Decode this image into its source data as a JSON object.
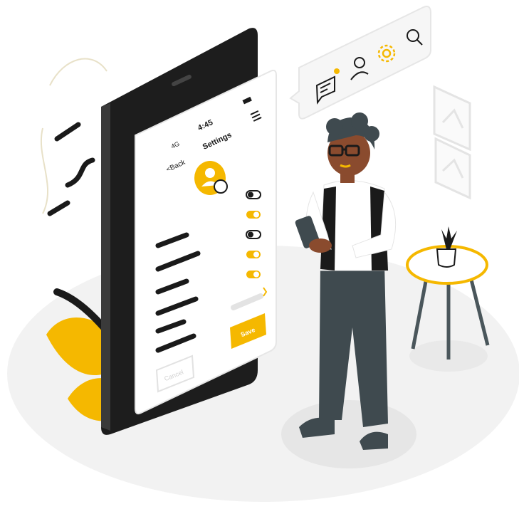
{
  "colors": {
    "accent": "#f5b800",
    "dark": "#1a1a1a",
    "phone_body": "#1d1d1d",
    "screen_bg": "#ffffff",
    "floor": "#f0f0f0",
    "pants": "#3f4a4f",
    "skin": "#8a4b2e"
  },
  "phone": {
    "status": {
      "signal": "4G",
      "time": "4:45"
    },
    "header": {
      "back_label": "<Back",
      "title": "Settings"
    },
    "toggles": [
      {
        "state": "off"
      },
      {
        "state": "on"
      },
      {
        "state": "off"
      },
      {
        "state": "on"
      },
      {
        "state": "on"
      }
    ],
    "save_label": "Save",
    "cancel_label": "Cancel"
  },
  "toolbar_icons": [
    "chat-icon",
    "user-icon",
    "gear-icon",
    "search-icon"
  ]
}
